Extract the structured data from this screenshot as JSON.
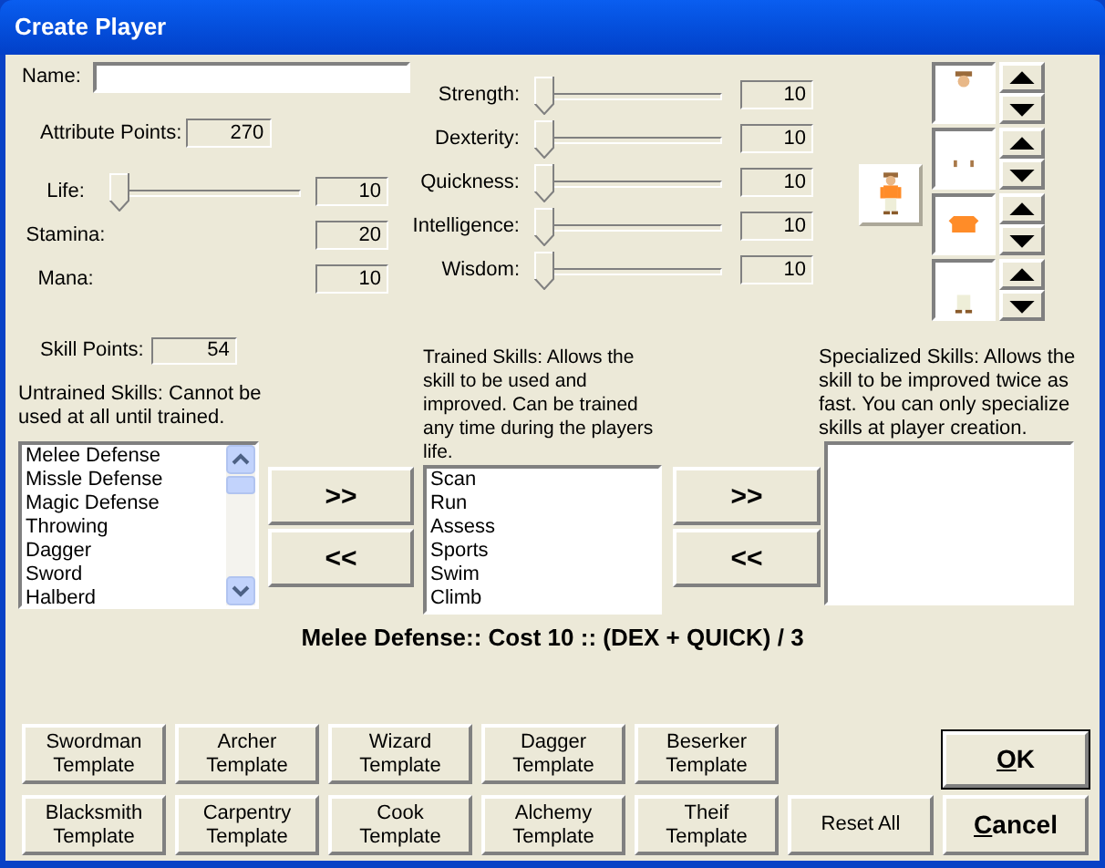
{
  "window": {
    "title": "Create Player"
  },
  "name_field": {
    "label": "Name:"
  },
  "attribute_points": {
    "label": "Attribute Points:",
    "value": "270"
  },
  "vitals": [
    {
      "kind": "slider",
      "label": "Life:",
      "level": 0,
      "value": "10"
    },
    {
      "kind": "readout",
      "label": "Stamina:",
      "value": "20"
    },
    {
      "kind": "readout",
      "label": "Mana:",
      "value": "10"
    }
  ],
  "attributes": [
    {
      "label": "Strength:",
      "level": 0,
      "value": "10"
    },
    {
      "label": "Dexterity:",
      "level": 0,
      "value": "10"
    },
    {
      "label": "Quickness:",
      "level": 0,
      "value": "10"
    },
    {
      "label": "Intelligence:",
      "level": 0,
      "value": "10"
    },
    {
      "label": "Wisdom:",
      "level": 0,
      "value": "10"
    }
  ],
  "appearance_parts": [
    {
      "kind": "head"
    },
    {
      "kind": "hands"
    },
    {
      "kind": "shirt"
    },
    {
      "kind": "pants"
    }
  ],
  "skill_points": {
    "label": "Skill Points:",
    "value": "54"
  },
  "untrained_skills": {
    "description": "Untrained Skills: Cannot be used at all until trained.",
    "items": [
      "Melee Defense",
      "Missle Defense",
      "Magic Defense",
      "Throwing",
      "Dagger",
      "Sword",
      "Halberd"
    ]
  },
  "train_buttons": [
    ">>",
    "<<"
  ],
  "trained_skills": {
    "description": "Trained Skills: Allows the skill to be used and improved. Can be trained any time during the players life.",
    "items": [
      "Scan",
      "Run",
      "Assess",
      "Sports",
      "Swim",
      "Climb"
    ]
  },
  "specialize_buttons": [
    ">>",
    "<<"
  ],
  "specialized_skills": {
    "description": "Specialized Skills: Allows the skill to be improved twice as fast. You can only specialize skills at player creation."
  },
  "skill_info": "Melee Defense:: Cost 10 :: (DEX + QUICK) / 3",
  "templates": [
    "Swordman Template",
    "Archer Template",
    "Wizard Template",
    "Dagger Template",
    "Beserker Template",
    "Blacksmith Template",
    "Carpentry Template",
    "Cook Template",
    "Alchemy Template",
    "Theif Template"
  ],
  "reset_button": "Reset All",
  "ok_button": {
    "label": "OK",
    "first_letter_underlined": true
  },
  "cancel_button": {
    "label": "Cancel",
    "first_letter_underlined": true
  }
}
